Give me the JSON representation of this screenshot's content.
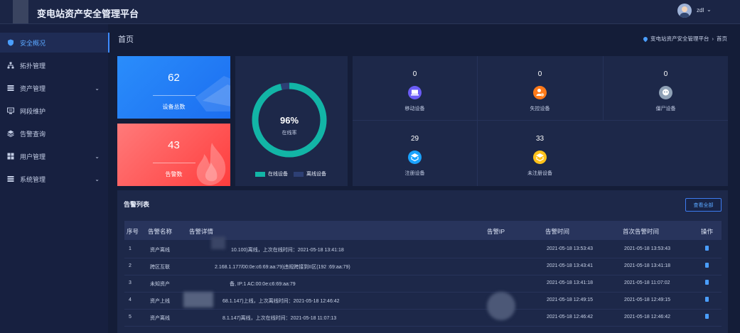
{
  "app": {
    "title": "变电站资产安全管理平台",
    "username": "zdl",
    "chevron": "⌄"
  },
  "sidebar": {
    "items": [
      {
        "label": "安全概况",
        "icon": "shield-icon",
        "active": true
      },
      {
        "label": "拓扑管理",
        "icon": "topology-icon"
      },
      {
        "label": "资产管理",
        "icon": "list-icon",
        "expandable": true
      },
      {
        "label": "网段维护",
        "icon": "network-icon"
      },
      {
        "label": "告警查询",
        "icon": "layers-icon"
      },
      {
        "label": "用户管理",
        "icon": "grid-icon",
        "expandable": true
      },
      {
        "label": "系统管理",
        "icon": "list-icon",
        "expandable": true
      }
    ]
  },
  "page": {
    "title": "首页",
    "breadcrumb": [
      "变电站资产安全管理平台",
      "首页"
    ],
    "breadcrumb_sep": "›"
  },
  "cards": {
    "devices": {
      "value": "62",
      "label": "设备总数"
    },
    "alerts": {
      "value": "43",
      "label": "告警数"
    }
  },
  "ring": {
    "percent_text": "96%",
    "percent": 0.96,
    "label": "在线率",
    "legend": [
      {
        "label": "在线设备",
        "color": "#12b5a6"
      },
      {
        "label": "离线设备",
        "color": "#2d3f74"
      }
    ]
  },
  "stats": [
    {
      "value": "0",
      "label": "移动设备",
      "color": "#6b5cf6",
      "icon": "laptop-icon"
    },
    {
      "value": "0",
      "label": "失控设备",
      "color": "#ff7a1a",
      "icon": "warning-person-icon"
    },
    {
      "value": "0",
      "label": "僵尸设备",
      "color": "#8fa1b6",
      "icon": "zombie-icon"
    },
    {
      "value": "29",
      "label": "注册设备",
      "color": "#1aa3ff",
      "icon": "registered-icon"
    },
    {
      "value": "33",
      "label": "未注册设备",
      "color": "#ffc21a",
      "icon": "unregistered-icon"
    }
  ],
  "alerts_table": {
    "title": "告警列表",
    "view_all": "查看全部",
    "columns": [
      "序号",
      "告警名称",
      "告警详情",
      "告警IP",
      "告警时间",
      "首次告警时间",
      "操作"
    ],
    "rows": [
      {
        "no": "1",
        "name": "资产离线",
        "detail": "10.100)离线，上次在线时间：2021-05-18 13:41:18",
        "time": "2021-05-18 13:53:43",
        "first": "2021-05-18 13:53:43"
      },
      {
        "no": "2",
        "name": "跨区互联",
        "detail": "2.168.1.177/00:0e:c6:69:aa:79)违规跨接到II区(192                         :69:aa:79)",
        "time": "2021-05-18 13:43:41",
        "first": "2021-05-18 13:41:18"
      },
      {
        "no": "3",
        "name": "未知资产",
        "detail": "备, IP:1                    AC:00:0e:c6:69:aa:79",
        "time": "2021-05-18 13:41:18",
        "first": "2021-05-18 11:07:02"
      },
      {
        "no": "4",
        "name": "资产上线",
        "detail": "68.1.147)上线，上次离线时间：2021-05-18 12:46:42",
        "time": "2021-05-18 12:49:15",
        "first": "2021-05-18 12:49:15"
      },
      {
        "no": "5",
        "name": "资产离线",
        "detail": "8.1.147)离线，上次在线时间：2021-05-18 11:07:13",
        "time": "2021-05-18 12:46:42",
        "first": "2021-05-18 12:46:42"
      }
    ]
  }
}
